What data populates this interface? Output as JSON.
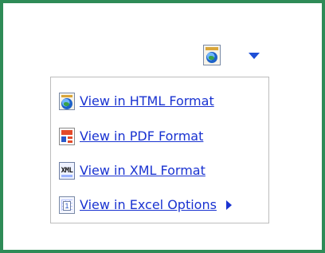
{
  "toolbar": {
    "format_icon": "html-format-icon",
    "dropdown_icon": "dropdown-arrow-icon"
  },
  "menu": {
    "items": [
      {
        "label": "View in HTML Format",
        "icon": "html-format-icon"
      },
      {
        "label": "View in PDF Format",
        "icon": "pdf-format-icon"
      },
      {
        "label": "View in XML Format",
        "icon": "xml-format-icon"
      },
      {
        "label": "View in Excel Options",
        "icon": "excel-options-icon",
        "has_submenu": true
      }
    ]
  },
  "icons": {
    "xml_text": "XML"
  },
  "colors": {
    "frame_border": "#2e8b57",
    "link": "#1a33d1",
    "arrow": "#1e4fd6"
  }
}
